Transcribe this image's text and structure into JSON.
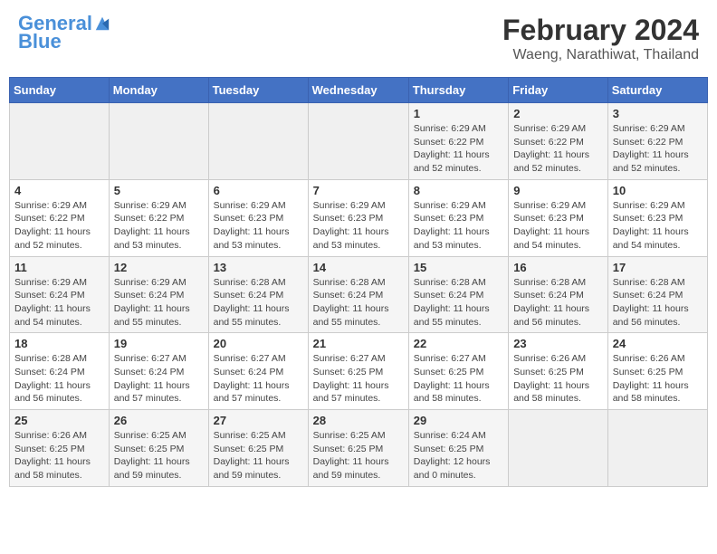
{
  "header": {
    "logo_line1": "General",
    "logo_line2": "Blue",
    "month": "February 2024",
    "location": "Waeng, Narathiwat, Thailand"
  },
  "days_of_week": [
    "Sunday",
    "Monday",
    "Tuesday",
    "Wednesday",
    "Thursday",
    "Friday",
    "Saturday"
  ],
  "weeks": [
    [
      {
        "day": "",
        "info": ""
      },
      {
        "day": "",
        "info": ""
      },
      {
        "day": "",
        "info": ""
      },
      {
        "day": "",
        "info": ""
      },
      {
        "day": "1",
        "info": "Sunrise: 6:29 AM\nSunset: 6:22 PM\nDaylight: 11 hours and 52 minutes."
      },
      {
        "day": "2",
        "info": "Sunrise: 6:29 AM\nSunset: 6:22 PM\nDaylight: 11 hours and 52 minutes."
      },
      {
        "day": "3",
        "info": "Sunrise: 6:29 AM\nSunset: 6:22 PM\nDaylight: 11 hours and 52 minutes."
      }
    ],
    [
      {
        "day": "4",
        "info": "Sunrise: 6:29 AM\nSunset: 6:22 PM\nDaylight: 11 hours and 52 minutes."
      },
      {
        "day": "5",
        "info": "Sunrise: 6:29 AM\nSunset: 6:22 PM\nDaylight: 11 hours and 53 minutes."
      },
      {
        "day": "6",
        "info": "Sunrise: 6:29 AM\nSunset: 6:23 PM\nDaylight: 11 hours and 53 minutes."
      },
      {
        "day": "7",
        "info": "Sunrise: 6:29 AM\nSunset: 6:23 PM\nDaylight: 11 hours and 53 minutes."
      },
      {
        "day": "8",
        "info": "Sunrise: 6:29 AM\nSunset: 6:23 PM\nDaylight: 11 hours and 53 minutes."
      },
      {
        "day": "9",
        "info": "Sunrise: 6:29 AM\nSunset: 6:23 PM\nDaylight: 11 hours and 54 minutes."
      },
      {
        "day": "10",
        "info": "Sunrise: 6:29 AM\nSunset: 6:23 PM\nDaylight: 11 hours and 54 minutes."
      }
    ],
    [
      {
        "day": "11",
        "info": "Sunrise: 6:29 AM\nSunset: 6:24 PM\nDaylight: 11 hours and 54 minutes."
      },
      {
        "day": "12",
        "info": "Sunrise: 6:29 AM\nSunset: 6:24 PM\nDaylight: 11 hours and 55 minutes."
      },
      {
        "day": "13",
        "info": "Sunrise: 6:28 AM\nSunset: 6:24 PM\nDaylight: 11 hours and 55 minutes."
      },
      {
        "day": "14",
        "info": "Sunrise: 6:28 AM\nSunset: 6:24 PM\nDaylight: 11 hours and 55 minutes."
      },
      {
        "day": "15",
        "info": "Sunrise: 6:28 AM\nSunset: 6:24 PM\nDaylight: 11 hours and 55 minutes."
      },
      {
        "day": "16",
        "info": "Sunrise: 6:28 AM\nSunset: 6:24 PM\nDaylight: 11 hours and 56 minutes."
      },
      {
        "day": "17",
        "info": "Sunrise: 6:28 AM\nSunset: 6:24 PM\nDaylight: 11 hours and 56 minutes."
      }
    ],
    [
      {
        "day": "18",
        "info": "Sunrise: 6:28 AM\nSunset: 6:24 PM\nDaylight: 11 hours and 56 minutes."
      },
      {
        "day": "19",
        "info": "Sunrise: 6:27 AM\nSunset: 6:24 PM\nDaylight: 11 hours and 57 minutes."
      },
      {
        "day": "20",
        "info": "Sunrise: 6:27 AM\nSunset: 6:24 PM\nDaylight: 11 hours and 57 minutes."
      },
      {
        "day": "21",
        "info": "Sunrise: 6:27 AM\nSunset: 6:25 PM\nDaylight: 11 hours and 57 minutes."
      },
      {
        "day": "22",
        "info": "Sunrise: 6:27 AM\nSunset: 6:25 PM\nDaylight: 11 hours and 58 minutes."
      },
      {
        "day": "23",
        "info": "Sunrise: 6:26 AM\nSunset: 6:25 PM\nDaylight: 11 hours and 58 minutes."
      },
      {
        "day": "24",
        "info": "Sunrise: 6:26 AM\nSunset: 6:25 PM\nDaylight: 11 hours and 58 minutes."
      }
    ],
    [
      {
        "day": "25",
        "info": "Sunrise: 6:26 AM\nSunset: 6:25 PM\nDaylight: 11 hours and 58 minutes."
      },
      {
        "day": "26",
        "info": "Sunrise: 6:25 AM\nSunset: 6:25 PM\nDaylight: 11 hours and 59 minutes."
      },
      {
        "day": "27",
        "info": "Sunrise: 6:25 AM\nSunset: 6:25 PM\nDaylight: 11 hours and 59 minutes."
      },
      {
        "day": "28",
        "info": "Sunrise: 6:25 AM\nSunset: 6:25 PM\nDaylight: 11 hours and 59 minutes."
      },
      {
        "day": "29",
        "info": "Sunrise: 6:24 AM\nSunset: 6:25 PM\nDaylight: 12 hours and 0 minutes."
      },
      {
        "day": "",
        "info": ""
      },
      {
        "day": "",
        "info": ""
      }
    ]
  ]
}
